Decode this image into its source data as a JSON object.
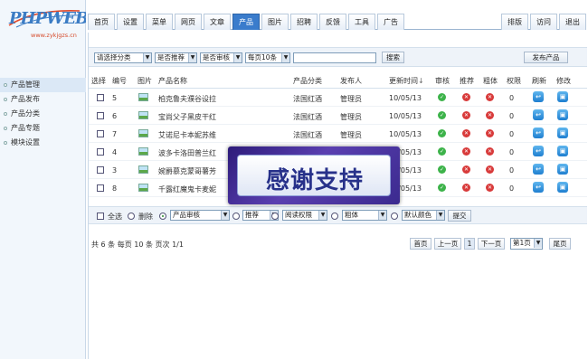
{
  "logo": {
    "brand": "PHPWEB",
    "url": "www.zykjgzs.cn"
  },
  "sidebar": {
    "items": [
      {
        "label": "产品管理",
        "active": true
      },
      {
        "label": "产品发布",
        "active": false
      },
      {
        "label": "产品分类",
        "active": false
      },
      {
        "label": "产品专题",
        "active": false
      },
      {
        "label": "模块设置",
        "active": false
      }
    ]
  },
  "nav": {
    "tabs": [
      "首页",
      "设置",
      "菜单",
      "网页",
      "文章",
      "产品",
      "图片",
      "招聘",
      "反馈",
      "工具",
      "广告"
    ],
    "active_tab": "产品",
    "right_tabs": [
      "排版",
      "访问",
      "退出"
    ]
  },
  "filters": {
    "category": "请选择分类",
    "recommend": "是否推荐",
    "review": "是否审核",
    "per_page": "每页10条",
    "search_value": "",
    "search_button": "搜索",
    "publish_button": "发布产品"
  },
  "table": {
    "headers": [
      "选择",
      "编号",
      "图片",
      "产品名称",
      "产品分类",
      "发布人",
      "更新时间",
      "审核",
      "推荐",
      "粗体",
      "权限",
      "刷新",
      "修改"
    ],
    "sort_arrow": "↓",
    "rows": [
      {
        "id": "5",
        "name": "柏克鲁夫濮谷设拉",
        "category": "法国红酒",
        "author": "管理员",
        "date": "10/05/13",
        "audit": true,
        "recommend": false,
        "bold": false,
        "perm": "0"
      },
      {
        "id": "6",
        "name": "宝尚父子黑皮干红",
        "category": "法国红酒",
        "author": "管理员",
        "date": "10/05/13",
        "audit": true,
        "recommend": false,
        "bold": false,
        "perm": "0"
      },
      {
        "id": "7",
        "name": "艾诺尼卡本妮苏维",
        "category": "法国红酒",
        "author": "管理员",
        "date": "10/05/13",
        "audit": true,
        "recommend": false,
        "bold": false,
        "perm": "0"
      },
      {
        "id": "4",
        "name": "波多卡洛田普兰红",
        "category": "法国红酒",
        "author": "管理员",
        "date": "10/05/13",
        "audit": true,
        "recommend": false,
        "bold": false,
        "perm": "0"
      },
      {
        "id": "3",
        "name": "婉爵慕克蒙哥薯芳",
        "category": "法国红酒",
        "author": "管理员",
        "date": "10/05/13",
        "audit": true,
        "recommend": false,
        "bold": false,
        "perm": "0"
      },
      {
        "id": "8",
        "name": "千露红魔鬼卡麦妮",
        "category": "法国红酒",
        "author": "管理员",
        "date": "10/05/13",
        "audit": true,
        "recommend": false,
        "bold": false,
        "perm": "0"
      }
    ]
  },
  "batch": {
    "select_all": "全选",
    "delete": "删除",
    "audit": "产品审核",
    "recommend": "推荐",
    "permission": "阅读权限",
    "bold": "粗体",
    "color": "默认颜色",
    "submit": "提交"
  },
  "pager": {
    "info": "共 6 条 每页 10 条 页次 1/1",
    "first": "首页",
    "prev": "上一页",
    "current": "1",
    "next": "下一页",
    "page_select": "第1页",
    "last": "尾页"
  },
  "overlay": {
    "text": "感谢支持"
  },
  "colors": {
    "accent": "#3a7ccc",
    "ok": "#3db34a",
    "no": "#d83a3a",
    "bar": "#eef3f9"
  }
}
